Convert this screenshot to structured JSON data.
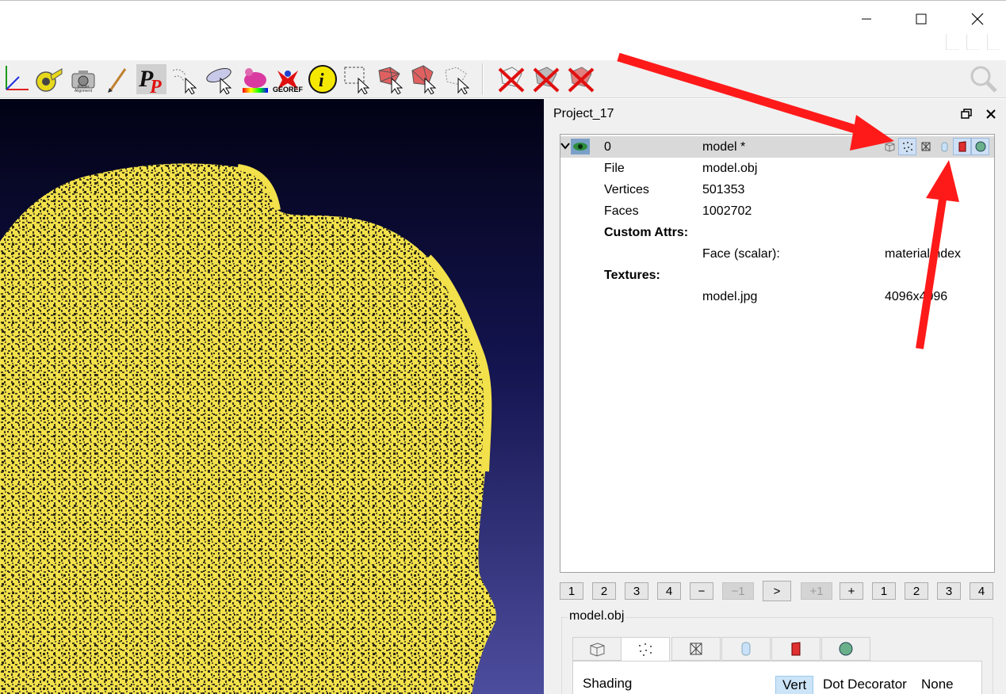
{
  "panel": {
    "title": "Project_17"
  },
  "tree": {
    "layer": {
      "id": "0",
      "name": "model *"
    },
    "rows": [
      {
        "label": "File",
        "value": "model.obj",
        "extra": ""
      },
      {
        "label": "Vertices",
        "value": "501353",
        "extra": ""
      },
      {
        "label": "Faces",
        "value": "1002702",
        "extra": ""
      },
      {
        "label": "Custom Attrs:",
        "value": "",
        "extra": ""
      },
      {
        "label": "",
        "value": "Face (scalar):",
        "extra": "materialIndex"
      },
      {
        "label": "Textures:",
        "value": "",
        "extra": ""
      },
      {
        "label": "",
        "value": "model.jpg",
        "extra": "4096x4096"
      }
    ]
  },
  "toolbar": {
    "georef_label": "GEOREF",
    "raster_label": "Raster Alignment"
  },
  "pager": {
    "buttons": [
      "1",
      "2",
      "3",
      "4",
      "−",
      "−1",
      ">",
      "+1",
      "+",
      "1",
      "2",
      "3",
      "4"
    ]
  },
  "decorators": {
    "group_title": "model.obj",
    "shading_label": "Shading",
    "options": [
      "Vert",
      "Dot Decorator",
      "None"
    ],
    "selected_option": "Vert"
  },
  "colors": {
    "mesh": "#f2e14a",
    "arrow": "#ff1a1a",
    "viewport_top": "#020215",
    "viewport_bottom": "#4d4d9e"
  },
  "icons": {
    "row": [
      "box-icon",
      "points-icon",
      "wireframe-icon",
      "cylinder-icon",
      "red-box-icon",
      "textured-sphere-icon"
    ]
  }
}
